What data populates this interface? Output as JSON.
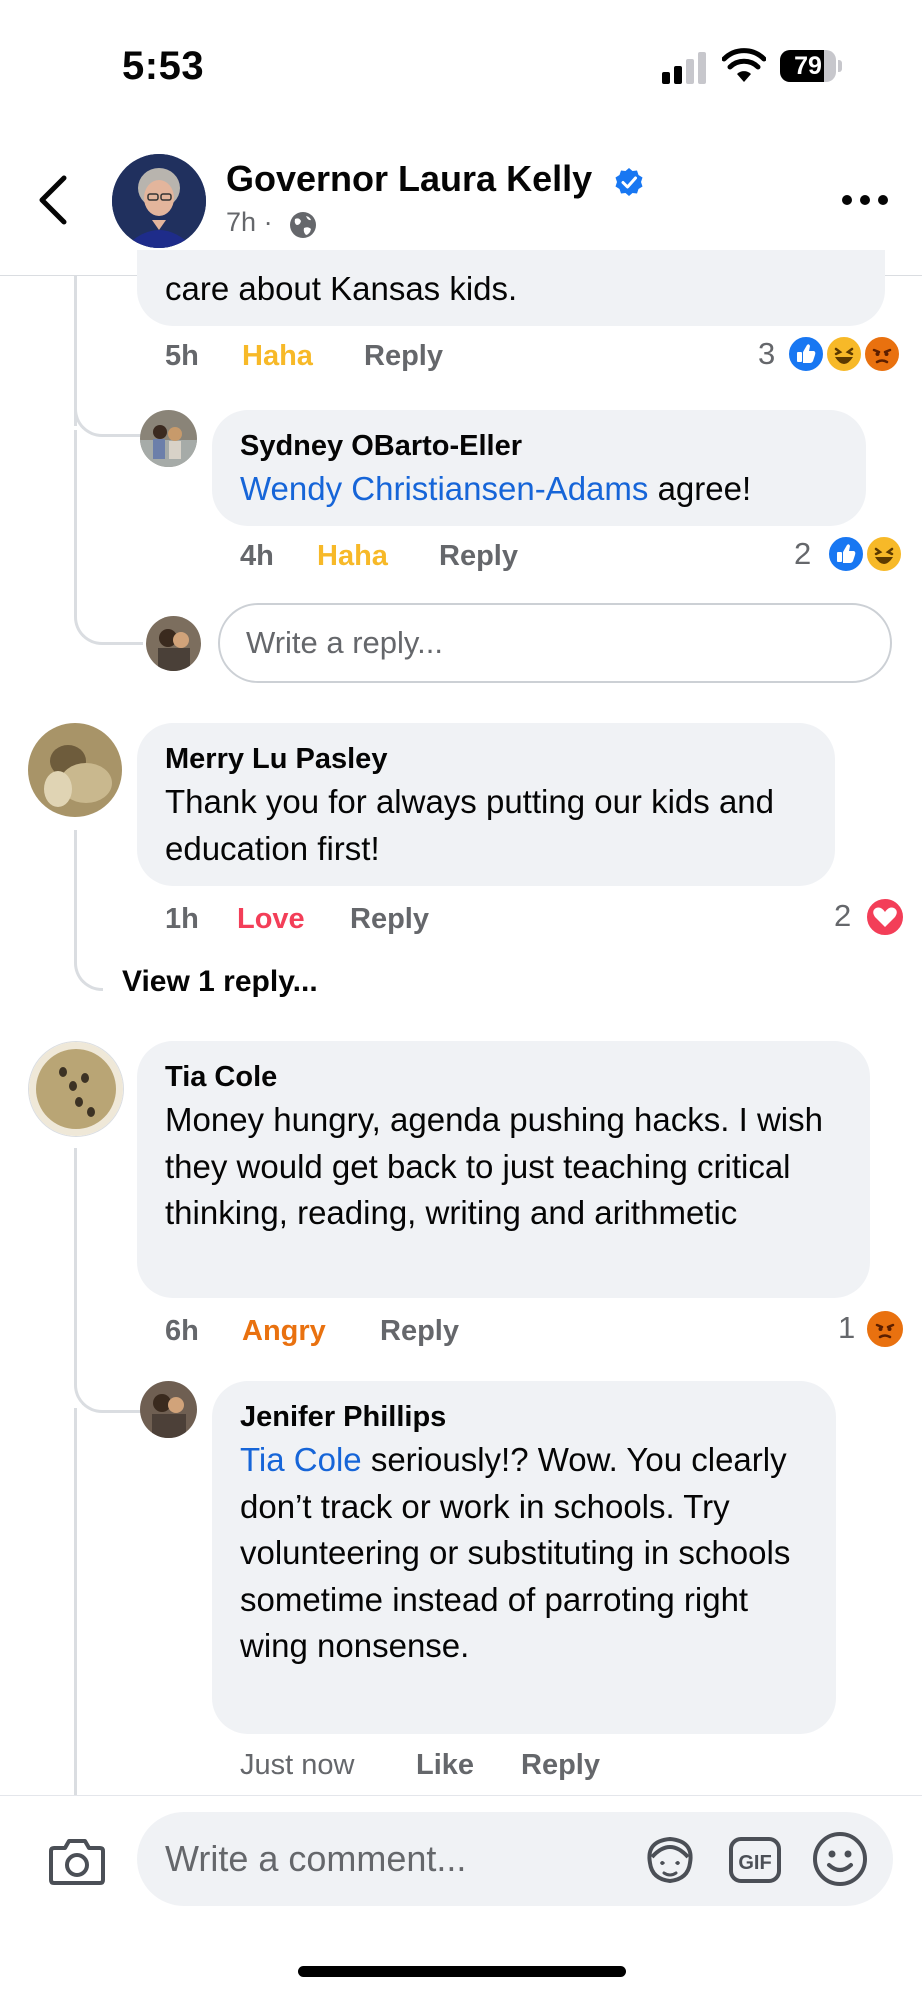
{
  "status_bar": {
    "time": "5:53",
    "battery": "79",
    "battery_level": 0.79
  },
  "header": {
    "page_name": "Governor Laura Kelly",
    "post_age": "7h",
    "separator": "·"
  },
  "thread1": {
    "tail_text": "care about Kansas kids.",
    "time": "5h",
    "reaction_label": "Haha",
    "reply_label": "Reply",
    "reaction_count": "3",
    "reply1": {
      "author": "Sydney OBarto-Eller",
      "mention": "Wendy Christiansen-Adams",
      "text": " agree!",
      "time": "4h",
      "reaction_label": "Haha",
      "reply_label": "Reply",
      "reaction_count": "2"
    },
    "reply_placeholder": "Write a reply..."
  },
  "comment2": {
    "author": "Merry Lu Pasley",
    "text": "Thank you for always putting our kids and education first!",
    "time": "1h",
    "reaction_label": "Love",
    "reply_label": "Reply",
    "reaction_count": "2",
    "view_replies": "View 1 reply..."
  },
  "comment3": {
    "author": "Tia Cole",
    "text": "Money hungry, agenda pushing hacks. I wish they would get back to just teaching critical thinking, reading, writing and arithmetic",
    "time": "6h",
    "reaction_label": "Angry",
    "reply_label": "Reply",
    "reaction_count": "1",
    "reply1": {
      "author": "Jenifer Phillips",
      "mention": "Tia Cole",
      "text": " seriously!? Wow. You clearly don’t track or work in schools. Try volunteering or substituting in schools sometime instead of parroting right wing nonsense.",
      "time": "Just now",
      "like_label": "Like",
      "reply_label": "Reply"
    }
  },
  "composer": {
    "placeholder": "Write a comment..."
  },
  "colors": {
    "haha": "#f7b928",
    "love": "#f33e58",
    "angry": "#e9710f",
    "mention": "#1665d8",
    "like": "#1877f2"
  }
}
